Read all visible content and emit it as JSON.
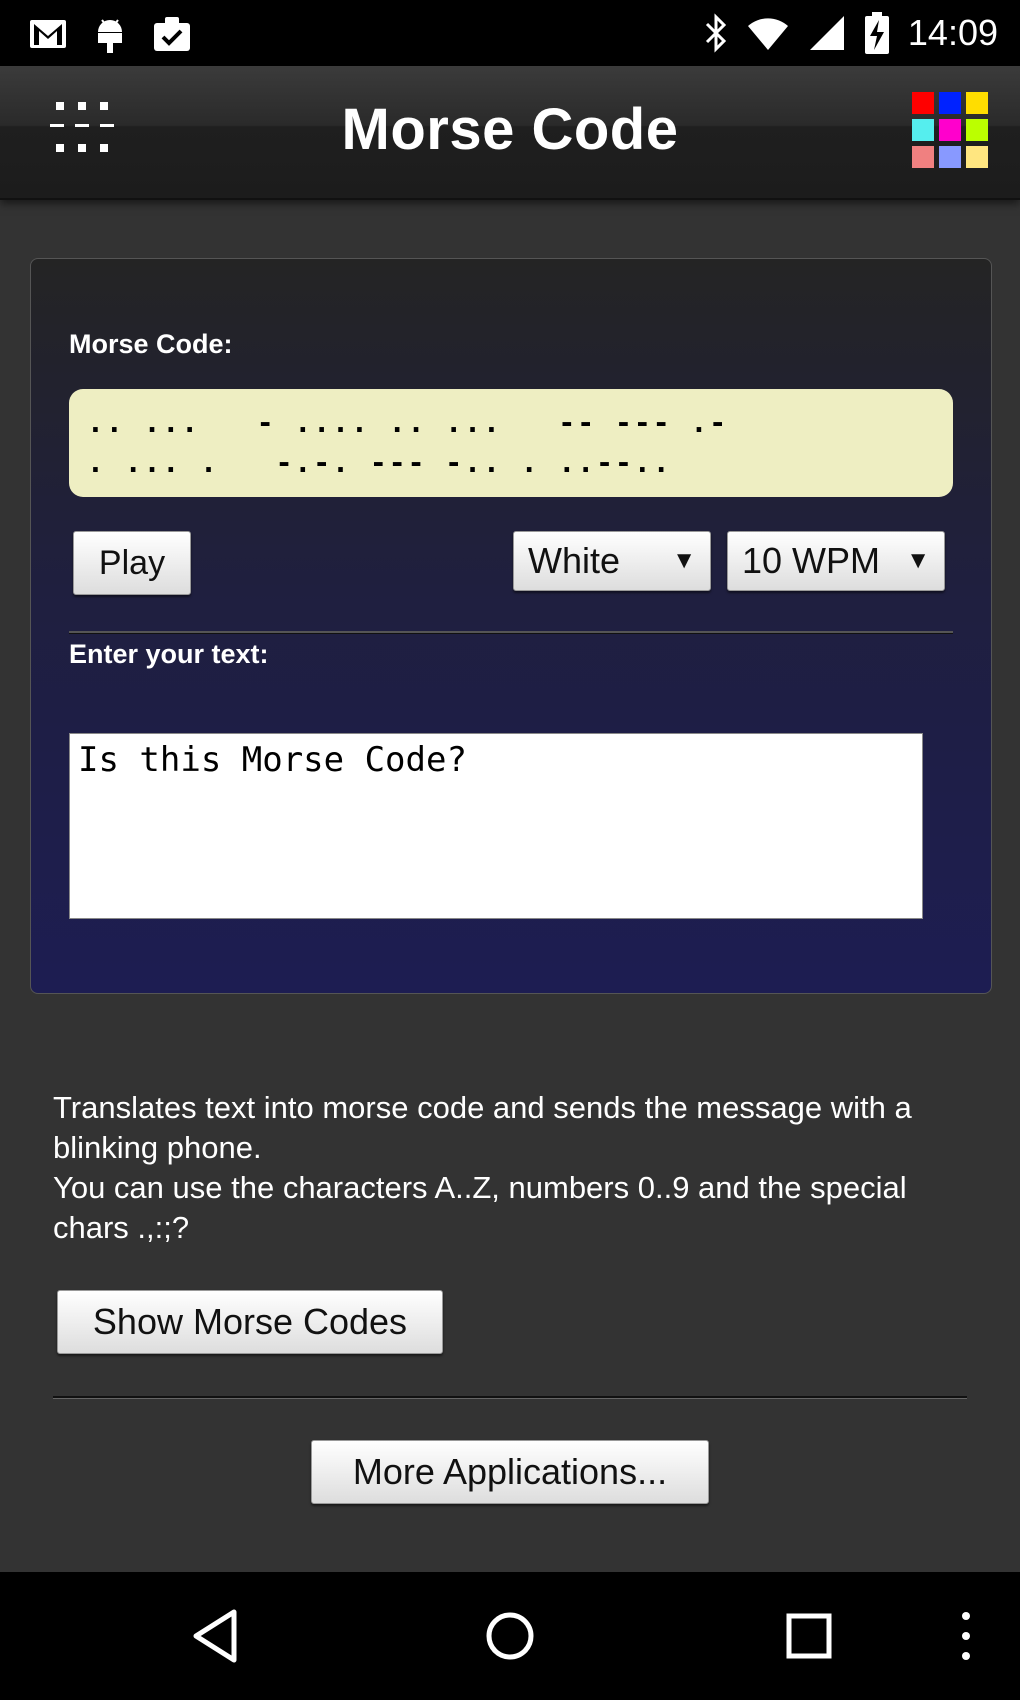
{
  "status_bar": {
    "time": "14:09",
    "icons_left": [
      "gmail-icon",
      "android-debug-icon",
      "clipboard-check-icon"
    ],
    "icons_right": [
      "bluetooth-icon",
      "wifi-icon",
      "cell-signal-icon",
      "battery-charging-icon"
    ]
  },
  "app_bar": {
    "title": "Morse Code",
    "menu_icon": "dots-menu-icon",
    "apps_icon": "color-grid-icon",
    "apps_icon_colors": [
      "#ff0000",
      "#0022ff",
      "#ffdd00",
      "#55eeee",
      "#ff00cc",
      "#bbff00",
      "#f08080",
      "#8899ff",
      "#ffe680"
    ]
  },
  "panel": {
    "morse_label": "Morse Code:",
    "morse_output_line1": ".. ...   - .... .. ...   -- --- .-",
    "morse_output_line2": ". ... .   -.-. --- -.. . ..--..",
    "play_label": "Play",
    "color_select": {
      "selected": "White"
    },
    "speed_select": {
      "selected": "10 WPM"
    },
    "input_label": "Enter your text:",
    "input_value": "Is this Morse Code?"
  },
  "description": {
    "line1": "Translates text into morse code and sends the message with a blinking phone.",
    "line2": "You can use the characters A..Z, numbers 0..9 and the special chars .,:;?"
  },
  "buttons": {
    "show_morse_codes": "Show Morse Codes",
    "more_applications": "More Applications..."
  },
  "nav_bar": {
    "icons": [
      "back-icon",
      "home-icon",
      "recents-icon",
      "overflow-menu-icon"
    ]
  },
  "colors": {
    "morse_output_bg": "#eeeec2",
    "background": "#333333"
  }
}
